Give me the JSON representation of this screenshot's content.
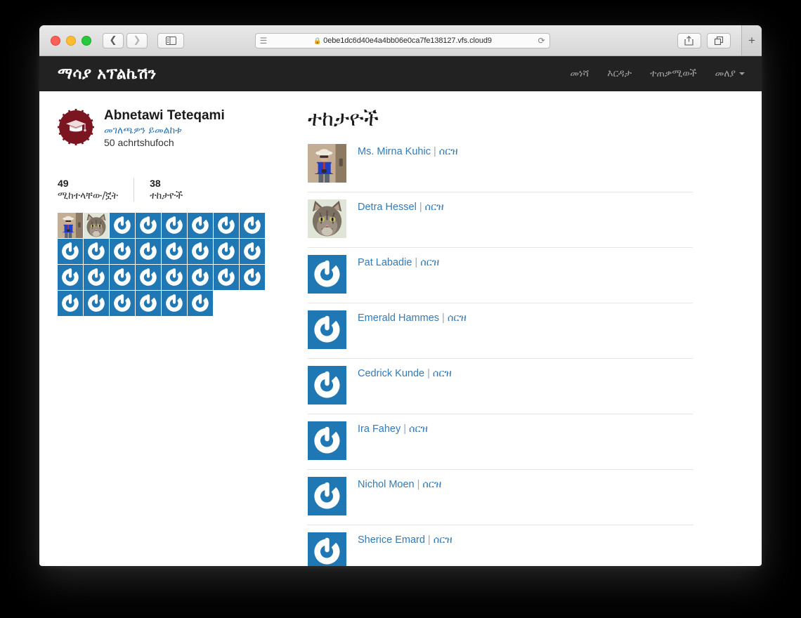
{
  "browser": {
    "url": "0ebe1dc6d40e4a4bb06e0ca7fe138127.vfs.cloud9",
    "lock_icon": "lock-icon",
    "reader_icon": "reader-view-icon",
    "reload_icon": "reload-icon",
    "back_icon": "back-chevron-icon",
    "forward_icon": "forward-chevron-icon",
    "sidebar_icon": "sidebar-toggle-icon",
    "share_icon": "share-icon",
    "tabs_icon": "show-tabs-icon",
    "newtab_label": "+"
  },
  "navbar": {
    "brand": "ማሳያ አፕልኬሽን",
    "links": [
      {
        "label": "መነሻ"
      },
      {
        "label": "እርዳታ"
      },
      {
        "label": "ተጠቃሚወች"
      },
      {
        "label": "መለያ",
        "has_caret": true
      }
    ]
  },
  "profile": {
    "avatar_icon": "graduation-cap-badge-avatar",
    "name": "Abnetawi Teteqami",
    "gravatar_link": "መገለጫዎን ይመልከቱ",
    "micropost_count": "50 achrtshufoch"
  },
  "stats": [
    {
      "number": "49",
      "label": "ሚከተላቸው/ኟት"
    },
    {
      "number": "38",
      "label": "ተከታዮች"
    }
  ],
  "avatar_grid": {
    "count": 30,
    "cells": [
      "photo-person",
      "photo-cat",
      "gravatar-default",
      "gravatar-default",
      "gravatar-default",
      "gravatar-default",
      "gravatar-default",
      "gravatar-default",
      "gravatar-default",
      "gravatar-default",
      "gravatar-default",
      "gravatar-default",
      "gravatar-default",
      "gravatar-default",
      "gravatar-default",
      "gravatar-default",
      "gravatar-default",
      "gravatar-default",
      "gravatar-default",
      "gravatar-default",
      "gravatar-default",
      "gravatar-default",
      "gravatar-default",
      "gravatar-default",
      "gravatar-default",
      "gravatar-default",
      "gravatar-default",
      "gravatar-default",
      "gravatar-default",
      "gravatar-default"
    ]
  },
  "main": {
    "heading": "ተከታዮች",
    "delete_label": "ሰርዝ",
    "separator": "|",
    "users": [
      {
        "name": "Ms. Mirna Kuhic",
        "avatar": "photo-person"
      },
      {
        "name": "Detra Hessel",
        "avatar": "photo-cat"
      },
      {
        "name": "Pat Labadie",
        "avatar": "gravatar-default"
      },
      {
        "name": "Emerald Hammes",
        "avatar": "gravatar-default"
      },
      {
        "name": "Cedrick Kunde",
        "avatar": "gravatar-default"
      },
      {
        "name": "Ira Fahey",
        "avatar": "gravatar-default"
      },
      {
        "name": "Nichol Moen",
        "avatar": "gravatar-default"
      },
      {
        "name": "Sherice Emard",
        "avatar": "gravatar-default"
      }
    ]
  },
  "colors": {
    "navbar_bg": "#222222",
    "link_blue": "#337ab7",
    "gravatar_blue": "#1f77b4",
    "badge_red": "#7b1520",
    "page_bg": "#ffffff",
    "desktop_bg": "#000000"
  }
}
